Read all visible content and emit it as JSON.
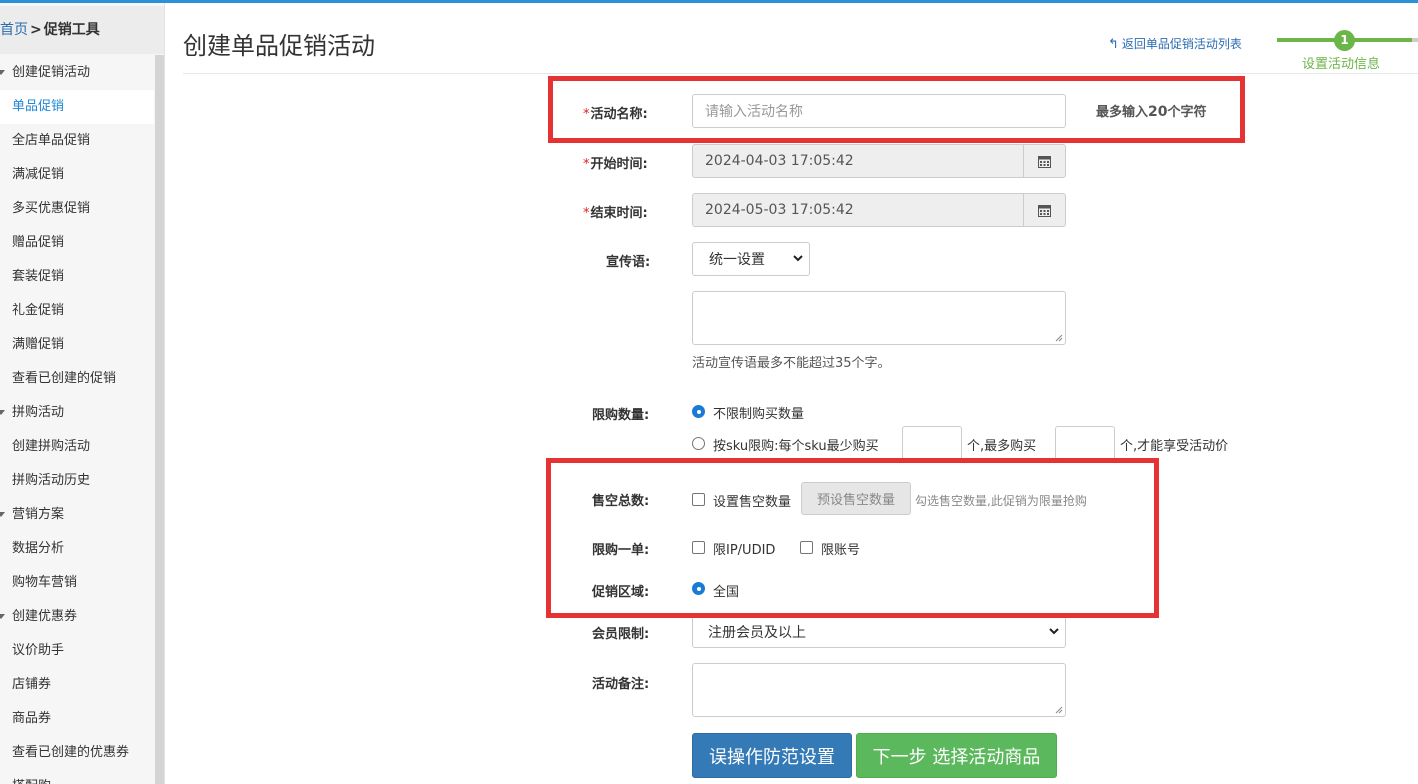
{
  "breadcrumb": {
    "home": "首页",
    "separator": ">",
    "current": "促销工具"
  },
  "sidebar": {
    "items": [
      {
        "label": "创建促销活动",
        "group": true
      },
      {
        "label": "单品促销",
        "active": true
      },
      {
        "label": "全店单品促销"
      },
      {
        "label": "满减促销"
      },
      {
        "label": "多买优惠促销"
      },
      {
        "label": "赠品促销"
      },
      {
        "label": "套装促销"
      },
      {
        "label": "礼金促销"
      },
      {
        "label": "满赠促销"
      },
      {
        "label": "查看已创建的促销"
      },
      {
        "label": "拼购活动",
        "group": true
      },
      {
        "label": "创建拼购活动"
      },
      {
        "label": "拼购活动历史"
      },
      {
        "label": "营销方案",
        "group": true
      },
      {
        "label": "数据分析"
      },
      {
        "label": "购物车营销"
      },
      {
        "label": "创建优惠券",
        "group": true
      },
      {
        "label": "议价助手"
      },
      {
        "label": "店铺券"
      },
      {
        "label": "商品券"
      },
      {
        "label": "查看已创建的优惠券"
      },
      {
        "label": "搭配购",
        "group": true
      }
    ]
  },
  "header": {
    "title": "创建单品促销活动",
    "back_link": "返回单品促销活动列表",
    "step_number": "1",
    "step_label": "设置活动信息"
  },
  "form": {
    "name": {
      "label": "活动名称:",
      "placeholder": "请输入活动名称",
      "limit_prefix": "最多输入",
      "limit_num": "20",
      "limit_suffix": "个字符"
    },
    "start": {
      "label": "开始时间:",
      "value": "2024-04-03 17:05:42"
    },
    "end": {
      "label": "结束时间:",
      "value": "2024-05-03 17:05:42"
    },
    "slogan": {
      "label": "宣传语:",
      "select_value": "统一设置",
      "hint": "活动宣传语最多不能超过35个字。"
    },
    "limit": {
      "label": "限购数量:",
      "opt_unlimited": "不限制购买数量",
      "opt_sku": "按sku限购:每个sku最少购买",
      "unit_mid": "个,最多购买",
      "unit_end": "个,才能享受活动价"
    },
    "sellout": {
      "label": "售空总数:",
      "check_label": "设置售空数量",
      "button": "预设售空数量",
      "hint": "勾选售空数量,此促销为限量抢购"
    },
    "one_order": {
      "label": "限购一单:",
      "ip_label": "限IP/UDID",
      "account_label": "限账号"
    },
    "region": {
      "label": "促销区域:",
      "value": "全国"
    },
    "member": {
      "label": "会员限制:",
      "value": "注册会员及以上"
    },
    "remark": {
      "label": "活动备注:"
    }
  },
  "buttons": {
    "misop": "误操作防范设置",
    "next": "下一步 选择活动商品"
  },
  "colors": {
    "accent_blue": "#337ab7",
    "accent_green": "#5cb85c",
    "step_green": "#6cb548",
    "highlight_red": "#e53333"
  }
}
